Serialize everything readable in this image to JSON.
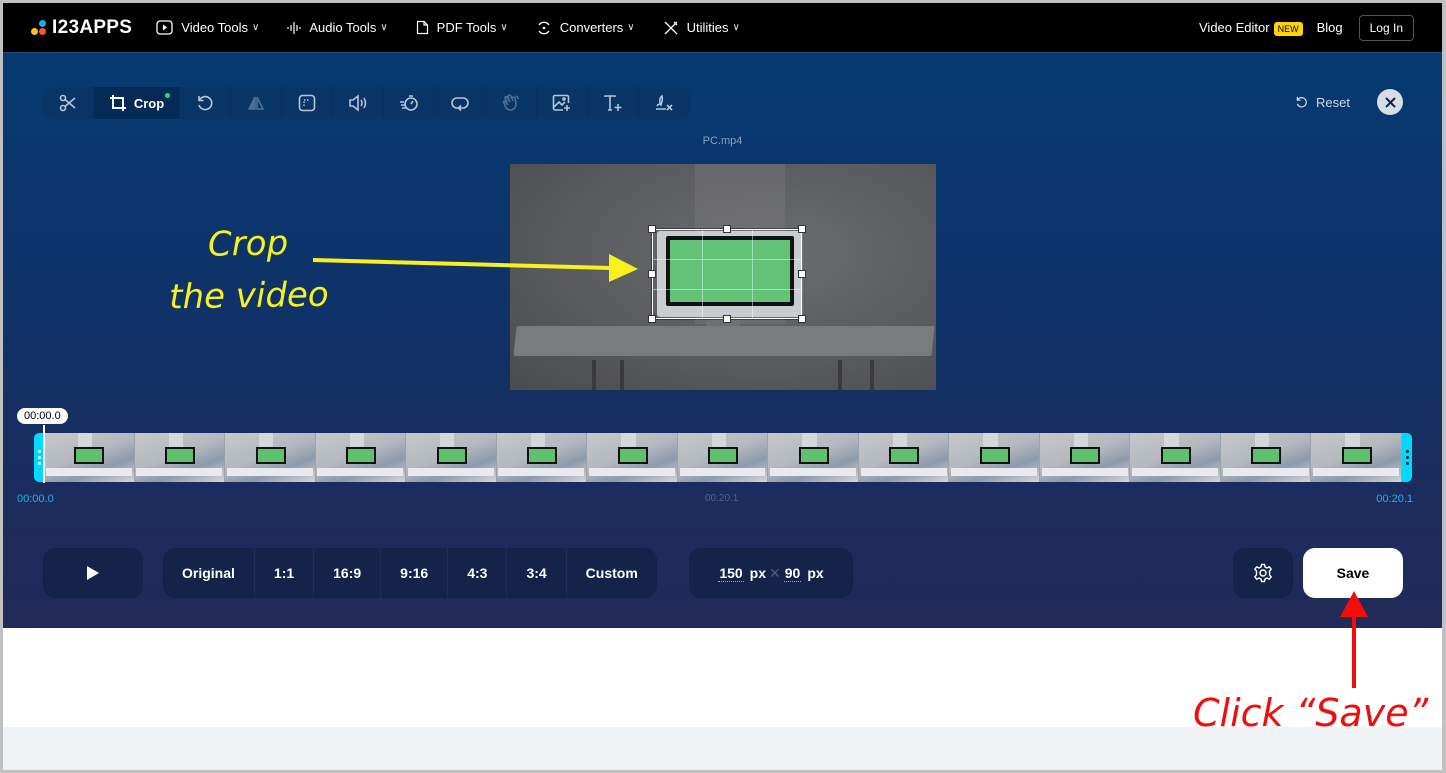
{
  "topnav": {
    "logo_text": "I23APPS",
    "items": [
      {
        "label": "Video Tools",
        "icon": "play-square-icon"
      },
      {
        "label": "Audio Tools",
        "icon": "waveform-icon"
      },
      {
        "label": "PDF Tools",
        "icon": "file-icon"
      },
      {
        "label": "Converters",
        "icon": "convert-icon"
      },
      {
        "label": "Utilities",
        "icon": "tools-icon"
      }
    ],
    "video_editor": "Video Editor",
    "new_badge": "NEW",
    "blog": "Blog",
    "login": "Log In",
    "chevron": "∨"
  },
  "editor": {
    "toolbar": [
      {
        "name": "cut",
        "icon": "scissors-icon",
        "state": "enabled"
      },
      {
        "name": "crop",
        "icon": "crop-icon",
        "label": "Crop",
        "state": "active"
      },
      {
        "name": "rotate",
        "icon": "rotate-icon",
        "state": "enabled"
      },
      {
        "name": "flip",
        "icon": "flip-icon",
        "state": "disabled"
      },
      {
        "name": "resize",
        "icon": "resize-icon",
        "state": "enabled"
      },
      {
        "name": "volume",
        "icon": "volume-icon",
        "state": "enabled"
      },
      {
        "name": "speed",
        "icon": "speed-icon",
        "state": "enabled"
      },
      {
        "name": "loop",
        "icon": "loop-icon",
        "state": "enabled"
      },
      {
        "name": "stabilize",
        "icon": "hand-wave-icon",
        "state": "disabled"
      },
      {
        "name": "add-image",
        "icon": "add-image-icon",
        "state": "enabled"
      },
      {
        "name": "add-text",
        "icon": "add-text-icon",
        "state": "enabled"
      },
      {
        "name": "remove-logo",
        "icon": "remove-logo-icon",
        "state": "enabled"
      }
    ],
    "reset_label": "Reset",
    "filename": "PC.mp4",
    "timeline": {
      "playhead_time": "00:00.0",
      "start_time": "00:00.0",
      "duration_mid": "00:20.1",
      "end_time": "00:20.1",
      "frame_count": 15
    },
    "play_icon": "play-icon",
    "aspect_ratios": [
      "Original",
      "1:1",
      "16:9",
      "9:16",
      "4:3",
      "3:4",
      "Custom"
    ],
    "size": {
      "width": "150",
      "height": "90",
      "unit": "px",
      "separator": "✕"
    },
    "save_label": "Save"
  },
  "annotations": {
    "crop_note_line1": "Crop",
    "crop_note_line2": "the video",
    "save_note": "Click “Save”",
    "crop_color": "#f7f21c",
    "save_color": "#f20d0d"
  },
  "colors": {
    "accent_cyan": "#00d9ff",
    "new_badge": "#ffd400",
    "active_dot": "#1be07e"
  }
}
